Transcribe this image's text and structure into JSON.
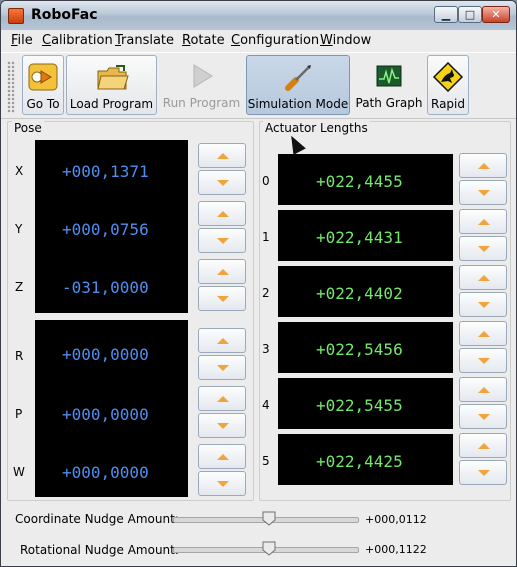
{
  "window": {
    "title": "RoboFac",
    "controls": {
      "minimize": "▁",
      "maximize": "□",
      "close": "✕"
    }
  },
  "menu": [
    {
      "mnemonic": "F",
      "rest": "ile"
    },
    {
      "mnemonic": "C",
      "rest": "alibration"
    },
    {
      "mnemonic": "T",
      "rest": "ranslate"
    },
    {
      "mnemonic": "R",
      "rest": "otate"
    },
    {
      "mnemonic": "C",
      "rest": "onfiguration"
    },
    {
      "mnemonic": "W",
      "rest": "indow"
    }
  ],
  "toolbar": {
    "goto": {
      "label": "Go To",
      "icon": "goto-icon"
    },
    "load": {
      "label": "Load Program",
      "icon": "folder-open-icon"
    },
    "run": {
      "label": "Run Program",
      "icon": "play-icon",
      "enabled": false
    },
    "sim": {
      "label": "Simulation Mode",
      "icon": "screwdriver-icon",
      "toggled": true
    },
    "path": {
      "label": "Path Graph",
      "icon": "graph-icon"
    },
    "rapid": {
      "label": "Rapid",
      "icon": "kangaroo-sign-icon"
    }
  },
  "pose": {
    "title": "Pose",
    "position": [
      {
        "axis": "X",
        "value": "+000,1371"
      },
      {
        "axis": "Y",
        "value": "+000,0756"
      },
      {
        "axis": "Z",
        "value": "-031,0000"
      }
    ],
    "rotation": [
      {
        "axis": "R",
        "value": "+000,0000"
      },
      {
        "axis": "P",
        "value": "+000,0000"
      },
      {
        "axis": "W",
        "value": "+000,0000"
      }
    ]
  },
  "actuators": {
    "title": "Actuator Lengths",
    "items": [
      {
        "index": "0",
        "value": "+022,4455"
      },
      {
        "index": "1",
        "value": "+022,4431"
      },
      {
        "index": "2",
        "value": "+022,4402"
      },
      {
        "index": "3",
        "value": "+022,5456"
      },
      {
        "index": "4",
        "value": "+022,5455"
      },
      {
        "index": "5",
        "value": "+022,4425"
      }
    ]
  },
  "nudge": {
    "coordinate": {
      "label": "Coordinate Nudge Amount:",
      "value": "+000,0112",
      "position": 0.52
    },
    "rotational": {
      "label": "Rotational Nudge Amount:",
      "value": "+000,1122",
      "position": 0.52
    }
  },
  "colors": {
    "display_bg": "#000000",
    "pose_text": "#4f8ef0",
    "actuator_text": "#73e86b",
    "spin_arrow": "#f0a43a"
  }
}
